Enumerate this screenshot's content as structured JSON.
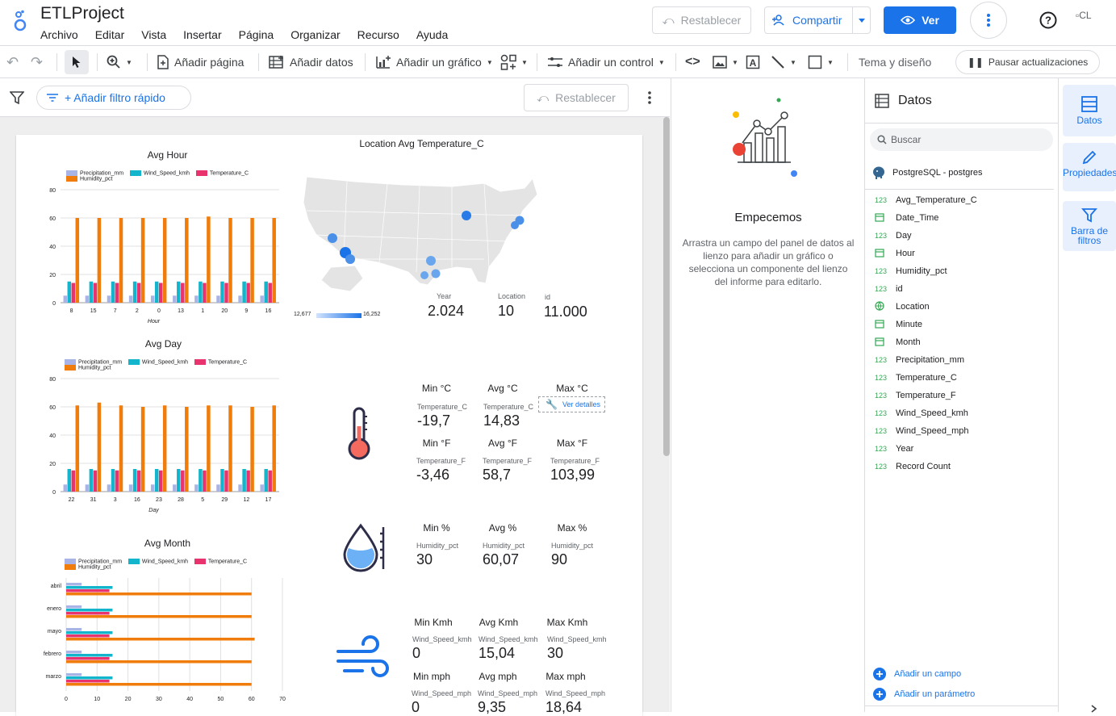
{
  "app": {
    "title": "ETLProject"
  },
  "menu": [
    "Archivo",
    "Editar",
    "Vista",
    "Insertar",
    "Página",
    "Organizar",
    "Recurso",
    "Ayuda"
  ],
  "header": {
    "reset_label": "Restablecer",
    "share_label": "Compartir",
    "view_label": "Ver",
    "avatar_alt": "CL"
  },
  "toolbar": {
    "add_page": "Añadir página",
    "add_data": "Añadir datos",
    "add_chart": "Añadir un gráfico",
    "add_control": "Añadir un control",
    "theme": "Tema y diseño",
    "pause": "Pausar actualizaciones"
  },
  "filterbar": {
    "quick_filter": "+ Añadir filtro rápido",
    "reset_label": "Restablecer"
  },
  "getstarted": {
    "title": "Empecemos",
    "text": "Arrastra un campo del panel de datos al lienzo para añadir un gráfico o selecciona un componente del lienzo del informe para editarlo."
  },
  "datapanel": {
    "title": "Datos",
    "search_placeholder": "Buscar",
    "source": "PostgreSQL - postgres",
    "fields": [
      {
        "type": "123",
        "name": "Avg_Temperature_C"
      },
      {
        "type": "cal",
        "name": "Date_Time"
      },
      {
        "type": "123",
        "name": "Day"
      },
      {
        "type": "cal",
        "name": "Hour"
      },
      {
        "type": "123",
        "name": "Humidity_pct"
      },
      {
        "type": "123",
        "name": "id"
      },
      {
        "type": "geo",
        "name": "Location"
      },
      {
        "type": "cal",
        "name": "Minute"
      },
      {
        "type": "cal",
        "name": "Month"
      },
      {
        "type": "123",
        "name": "Precipitation_mm"
      },
      {
        "type": "123",
        "name": "Temperature_C"
      },
      {
        "type": "123",
        "name": "Temperature_F"
      },
      {
        "type": "123",
        "name": "Wind_Speed_kmh"
      },
      {
        "type": "123",
        "name": "Wind_Speed_mph"
      },
      {
        "type": "123",
        "name": "Year"
      },
      {
        "type": "123",
        "name": "Record Count"
      }
    ],
    "add_field": "Añadir un campo",
    "add_param": "Añadir un parámetro"
  },
  "sidetabs": {
    "data": "Datos",
    "properties": "Propiedades",
    "filters": "Barra de filtros"
  },
  "colors": {
    "precip": "#a9b4e6",
    "wind": "#12b5cb",
    "temp": "#e8336e",
    "humidity": "#f07c0c",
    "accent": "#1a73e8"
  },
  "series_names": [
    "Precipitation_mm",
    "Wind_Speed_kmh",
    "Temperature_C",
    "Humidity_pct"
  ],
  "chart_data": [
    {
      "type": "bar",
      "title": "Avg Hour",
      "xlabel": "Hour",
      "ylim": [
        0,
        80
      ],
      "yticks": [
        0,
        20,
        40,
        60,
        80
      ],
      "categories": [
        "8",
        "15",
        "7",
        "2",
        "0",
        "13",
        "1",
        "20",
        "9",
        "16"
      ],
      "series": [
        {
          "name": "Precipitation_mm",
          "values": [
            5,
            5,
            5,
            5,
            5,
            5,
            5,
            5,
            5,
            5
          ]
        },
        {
          "name": "Wind_Speed_kmh",
          "values": [
            15,
            15,
            15,
            15,
            15,
            15,
            15,
            15,
            15,
            15
          ]
        },
        {
          "name": "Temperature_C",
          "values": [
            14,
            14,
            14,
            14,
            14,
            14,
            14,
            14,
            14,
            14
          ]
        },
        {
          "name": "Humidity_pct",
          "values": [
            60,
            60,
            60,
            60,
            60,
            60,
            61,
            60,
            60,
            60
          ]
        }
      ]
    },
    {
      "type": "bar",
      "title": "Avg Day",
      "xlabel": "Day",
      "ylim": [
        0,
        80
      ],
      "yticks": [
        0,
        20,
        40,
        60,
        80
      ],
      "categories": [
        "22",
        "31",
        "3",
        "16",
        "23",
        "28",
        "5",
        "29",
        "12",
        "17"
      ],
      "series": [
        {
          "name": "Precipitation_mm",
          "values": [
            5,
            5,
            5,
            5,
            5,
            5,
            5,
            5,
            5,
            5
          ]
        },
        {
          "name": "Wind_Speed_kmh",
          "values": [
            16,
            16,
            16,
            16,
            16,
            16,
            16,
            16,
            16,
            16
          ]
        },
        {
          "name": "Temperature_C",
          "values": [
            15,
            15,
            15,
            15,
            15,
            15,
            15,
            15,
            15,
            15
          ]
        },
        {
          "name": "Humidity_pct",
          "values": [
            61,
            63,
            61,
            60,
            61,
            60,
            61,
            61,
            60,
            61
          ]
        }
      ]
    },
    {
      "type": "bar",
      "orientation": "horizontal",
      "title": "Avg Month",
      "xlim": [
        0,
        70
      ],
      "xticks": [
        0,
        10,
        20,
        30,
        40,
        50,
        60,
        70
      ],
      "categories": [
        "abril",
        "enero",
        "mayo",
        "febrero",
        "marzo"
      ],
      "series": [
        {
          "name": "Precipitation_mm",
          "values": [
            5,
            5,
            5,
            5,
            5
          ]
        },
        {
          "name": "Wind_Speed_kmh",
          "values": [
            15,
            15,
            15,
            15,
            15
          ]
        },
        {
          "name": "Temperature_C",
          "values": [
            14,
            14,
            14,
            14,
            14
          ]
        },
        {
          "name": "Humidity_pct",
          "values": [
            60,
            60,
            61,
            60,
            60
          ]
        }
      ]
    }
  ],
  "map": {
    "title": "Location Avg Temperature_C",
    "legend_min": "12,677",
    "legend_max": "16,252"
  },
  "scorecards": [
    {
      "label": "Year",
      "value": "2.024"
    },
    {
      "label": "Location",
      "value": "10"
    },
    {
      "label": "id",
      "value": "11.000"
    }
  ],
  "temp_c": {
    "min_label": "Min °C",
    "avg_label": "Avg °C",
    "max_label": "Max °C",
    "field": "Temperature_C",
    "min": "-19,7",
    "avg": "14,83",
    "details": "Ver detalles"
  },
  "temp_f": {
    "min_label": "Min °F",
    "avg_label": "Avg °F",
    "max_label": "Max °F",
    "field": "Temperature_F",
    "min": "-3,46",
    "avg": "58,7",
    "max": "103,99"
  },
  "humidity": {
    "min_label": "Min %",
    "avg_label": "Avg %",
    "max_label": "Max %",
    "field": "Humidity_pct",
    "min": "30",
    "avg": "60,07",
    "max": "90"
  },
  "wind_kmh": {
    "min_label": "Min Kmh",
    "avg_label": "Avg Kmh",
    "max_label": "Max Kmh",
    "field": "Wind_Speed_kmh",
    "min": "0",
    "avg": "15,04",
    "max": "30"
  },
  "wind_mph": {
    "min_label": "Min mph",
    "avg_label": "Avg mph",
    "max_label": "Max mph",
    "field": "Wind_Speed_mph",
    "min": "0",
    "avg": "9,35",
    "max": "18,64"
  }
}
